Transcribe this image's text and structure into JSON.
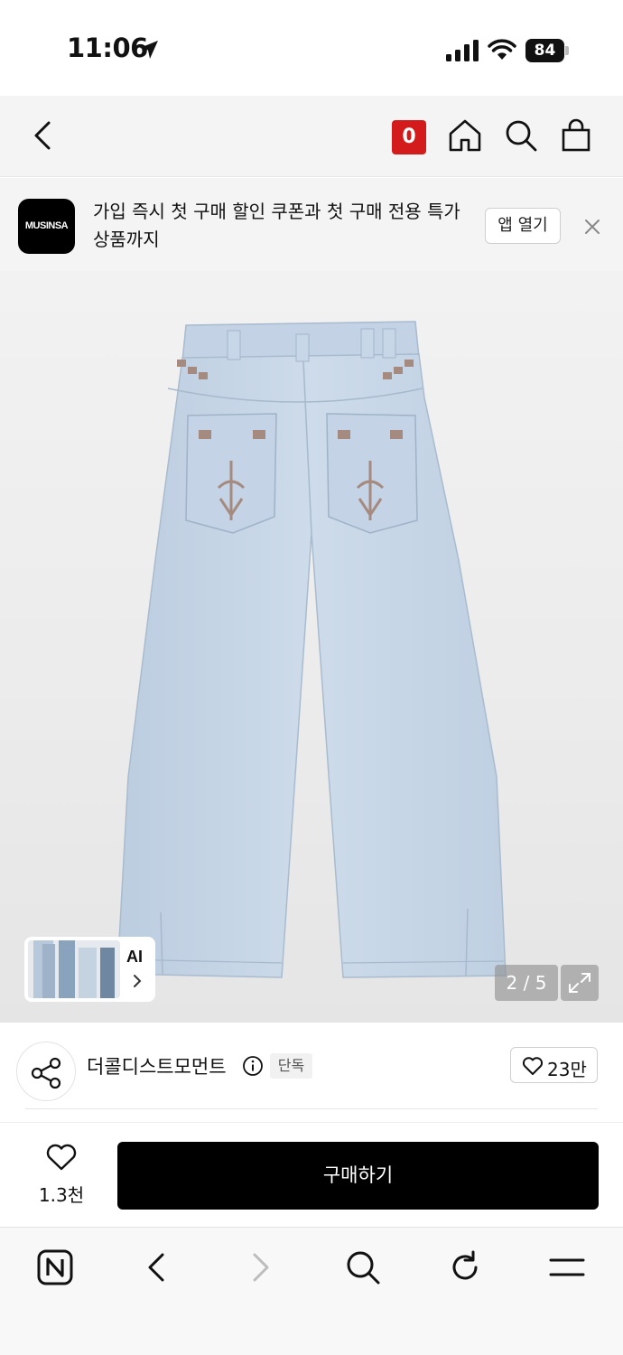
{
  "status_bar": {
    "time": "11:06",
    "battery": "84"
  },
  "nav": {
    "cart_count": "0"
  },
  "banner": {
    "logo_text": "MUSINSA",
    "message": "가입 즉시 첫 구매 할인 쿠폰과 첫 구매 전용 특가 상품까지",
    "open_app_label": "앱 열기"
  },
  "product_image": {
    "ai_label": "AI",
    "page_indicator": "2 / 5"
  },
  "brand": {
    "name": "더콜디스트모먼트",
    "badge": "단독",
    "like_count": "23만"
  },
  "buy_bar": {
    "wish_count": "1.3천",
    "buy_label": "구매하기"
  },
  "colors": {
    "accent_red": "#d41b1b",
    "button_black": "#000000",
    "denim": "#c7d6e6"
  },
  "icons": {
    "nav": [
      "back-icon",
      "home-icon",
      "search-icon",
      "shopping-bag-icon"
    ],
    "browser": [
      "naver-home-icon",
      "browser-back-icon",
      "browser-forward-icon",
      "browser-search-icon",
      "reload-icon",
      "menu-icon"
    ]
  }
}
